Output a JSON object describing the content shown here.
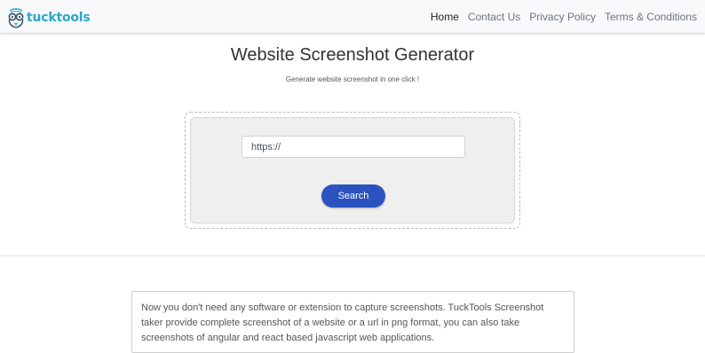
{
  "navbar": {
    "brand": "tucktools",
    "links": [
      {
        "label": "Home",
        "active": true
      },
      {
        "label": "Contact Us",
        "active": false
      },
      {
        "label": "Privacy Policy",
        "active": false
      },
      {
        "label": "Terms & Conditions",
        "active": false
      }
    ]
  },
  "main": {
    "title": "Website Screenshot Generator",
    "subtitle": "Generate website screenshot in one click !",
    "url_input": {
      "value": "",
      "placeholder": "https://"
    },
    "search_button": "Search"
  },
  "info": {
    "text": "Now you don't need any software or extension to capture screenshots. TuckTools Screenshot taker provide complete screenshot of a website or a url in png format, you can also take screenshots of angular and react based javascript web applications."
  },
  "colors": {
    "brand": "#2aa7c9",
    "button": "#2b52bf",
    "navbar_bg": "#f8f9fa",
    "panel_bg": "#efefef"
  }
}
